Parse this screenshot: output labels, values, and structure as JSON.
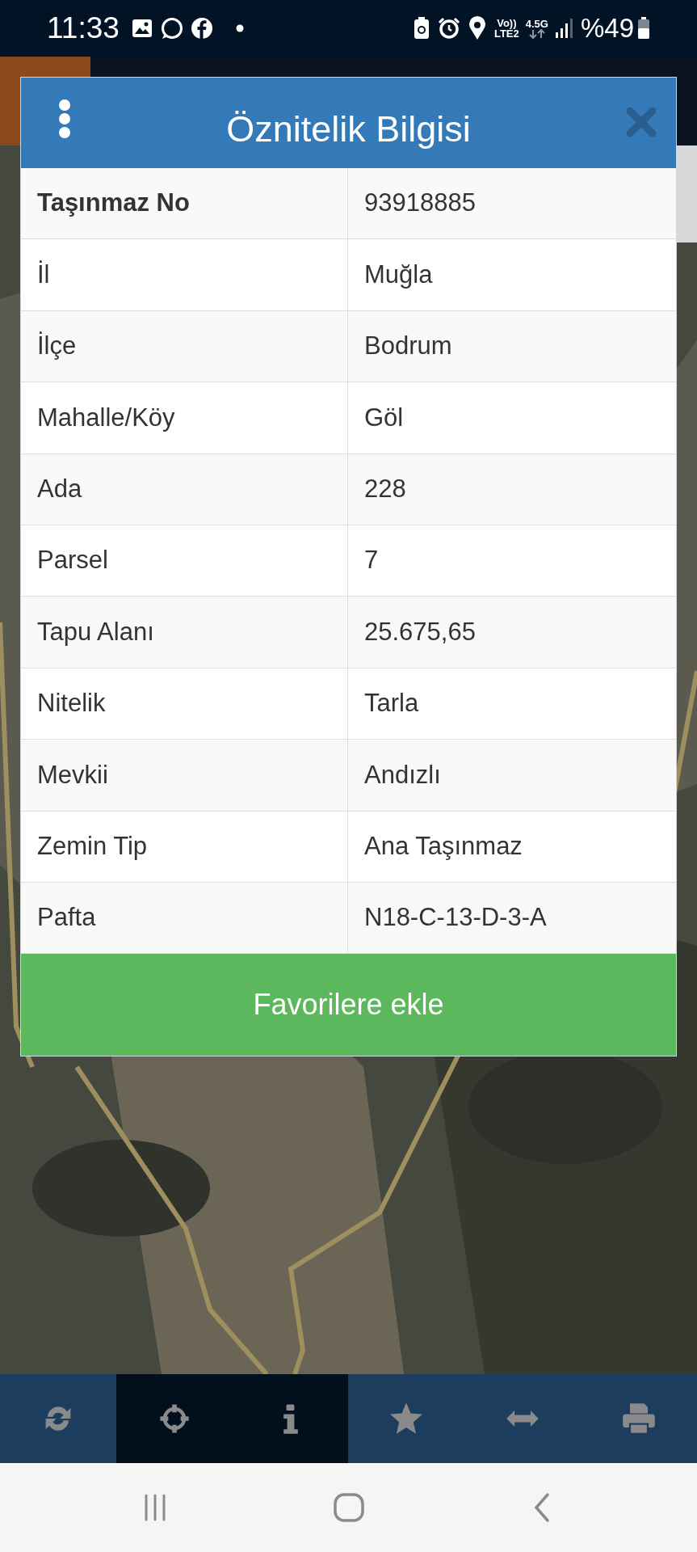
{
  "status_bar": {
    "time": "11:33",
    "volte": "Vo))",
    "lte": "LTE2",
    "network": "4.5G",
    "battery": "%49"
  },
  "dialog": {
    "title": "Öznitelik Bilgisi",
    "rows": [
      {
        "label": "Taşınmaz No",
        "value": "93918885",
        "bold": true
      },
      {
        "label": "İl",
        "value": "Muğla",
        "bold": false
      },
      {
        "label": "İlçe",
        "value": "Bodrum",
        "bold": false
      },
      {
        "label": "Mahalle/Köy",
        "value": "Göl",
        "bold": false
      },
      {
        "label": "Ada",
        "value": "228",
        "bold": false
      },
      {
        "label": "Parsel",
        "value": "7",
        "bold": false
      },
      {
        "label": "Tapu Alanı",
        "value": "25.675,65",
        "bold": false
      },
      {
        "label": "Nitelik",
        "value": "Tarla",
        "bold": false
      },
      {
        "label": "Mevkii",
        "value": "Andızlı",
        "bold": false
      },
      {
        "label": "Zemin Tip",
        "value": "Ana Taşınmaz",
        "bold": false
      },
      {
        "label": "Pafta",
        "value": "N18-C-13-D-3-A",
        "bold": false
      }
    ],
    "button": "Favorilere ekle"
  },
  "toolbar": [
    {
      "kind": "refresh",
      "selected": false
    },
    {
      "kind": "crosshair",
      "selected": true
    },
    {
      "kind": "info",
      "selected": true
    },
    {
      "kind": "star",
      "selected": false
    },
    {
      "kind": "measure",
      "selected": false
    },
    {
      "kind": "print",
      "selected": false
    }
  ],
  "nav_bar": [
    {
      "kind": "recents"
    },
    {
      "kind": "home"
    },
    {
      "kind": "back"
    }
  ]
}
